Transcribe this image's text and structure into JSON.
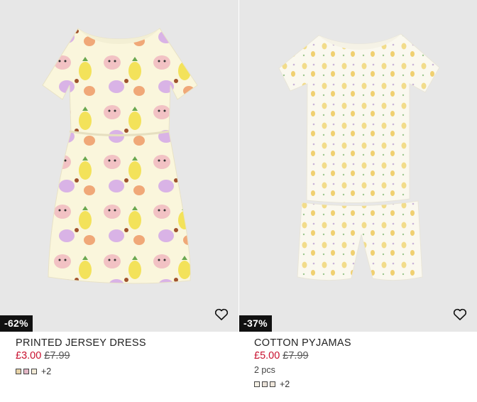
{
  "products": [
    {
      "title": "PRINTED JERSEY DRESS",
      "discount": "-62%",
      "price_new": "£3.00",
      "price_old": "£7.99",
      "meta": "",
      "swatch_colors": [
        "#e7d3a8",
        "#e3b7c6",
        "#f2ead6"
      ],
      "more_colors": "+2",
      "fav_icon": "heart-outline-icon"
    },
    {
      "title": "COTTON PYJAMAS",
      "discount": "-37%",
      "price_new": "£5.00",
      "price_old": "£7.99",
      "meta": "2 pcs",
      "swatch_colors": [
        "#f4f0e4",
        "#e9e1d8",
        "#efe6da"
      ],
      "more_colors": "+2",
      "fav_icon": "heart-outline-icon"
    }
  ],
  "colors": {
    "sale": "#c8102e",
    "badge_bg": "#111111",
    "image_bg": "#e7e7e7"
  }
}
